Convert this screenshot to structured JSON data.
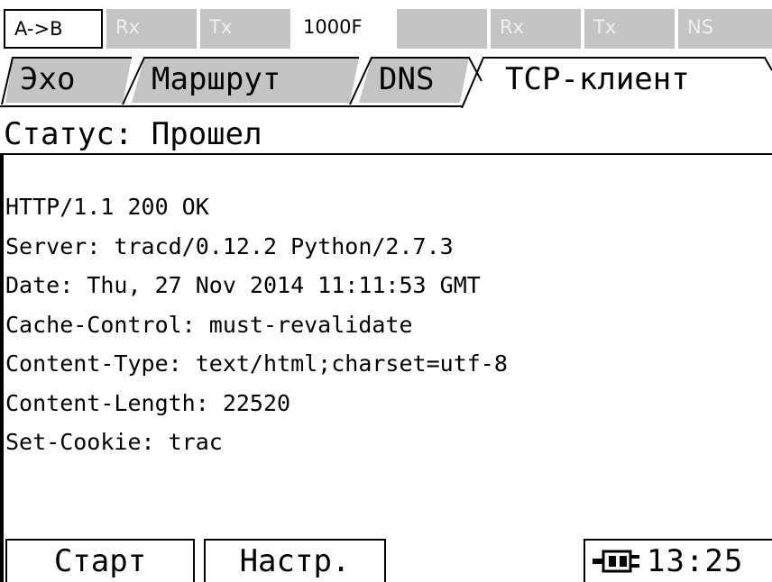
{
  "status_bar": {
    "cells": [
      {
        "label": "A->B",
        "style": "boxed"
      },
      {
        "label": "Rx",
        "style": "grey"
      },
      {
        "label": "Tx",
        "style": "grey"
      },
      {
        "label": "1000F",
        "style": "plain"
      },
      {
        "label": "",
        "style": "grey"
      },
      {
        "label": "Rx",
        "style": "grey"
      },
      {
        "label": "Tx",
        "style": "grey"
      },
      {
        "label": "NS",
        "style": "grey"
      }
    ]
  },
  "tabs": [
    {
      "label": "Эхо",
      "active": false
    },
    {
      "label": "Маршрут",
      "active": false
    },
    {
      "label": "DNS",
      "active": false
    },
    {
      "label": "TCP-клиент",
      "active": true
    }
  ],
  "status": {
    "text": "Статус: Прошел"
  },
  "response_lines": [
    "HTTP/1.1 200 OK",
    "Server: tracd/0.12.2 Python/2.7.3",
    "Date: Thu, 27 Nov 2014 11:11:53 GMT",
    "Cache-Control: must-revalidate",
    "Content-Type: text/html;charset=utf-8",
    "Content-Length: 22520",
    "Set-Cookie: trac"
  ],
  "buttons": {
    "start": "Старт",
    "settings": "Настр."
  },
  "clock": {
    "time": "13:25",
    "icon": "power-plug-icon"
  }
}
